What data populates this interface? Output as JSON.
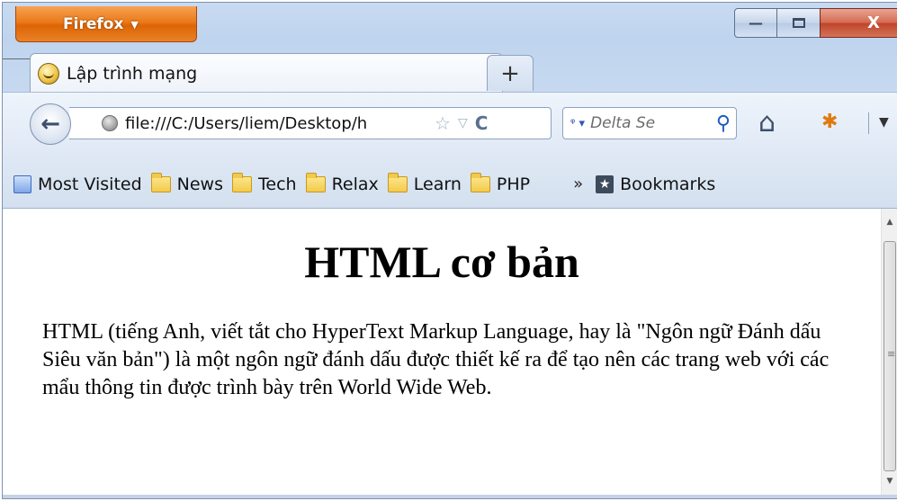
{
  "window": {
    "app_menu_label": "Firefox",
    "minimize_symbol": "—",
    "maximize_symbol": "▫",
    "close_symbol": "X"
  },
  "tab": {
    "title": "Lập trình mạng",
    "new_tab_symbol": "+"
  },
  "navigation": {
    "url": "file:///C:/Users/liem/Desktop/h",
    "search_placeholder": "Delta Se"
  },
  "bookmarks": {
    "items": [
      {
        "label": "Most Visited",
        "icon": "most-visited-icon"
      },
      {
        "label": "News",
        "icon": "folder-icon"
      },
      {
        "label": "Tech",
        "icon": "folder-icon"
      },
      {
        "label": "Relax",
        "icon": "folder-icon"
      },
      {
        "label": "Learn",
        "icon": "folder-icon"
      },
      {
        "label": "PHP",
        "icon": "folder-icon"
      }
    ],
    "overflow_symbol": "»",
    "menu_label": "Bookmarks"
  },
  "page": {
    "heading": "HTML cơ bản",
    "paragraph": "HTML (tiếng Anh, viết tắt cho HyperText Markup Language, hay là \"Ngôn ngữ Đánh dấu Siêu văn bản\") là một ngôn ngữ đánh dấu được thiết kế ra để tạo nên các trang web với các mẩu thông tin được trình bày trên World Wide Web."
  },
  "colors": {
    "firefox_button": "#e66f0f",
    "close_button": "#c7472c",
    "chrome_background": "#c6d9f0"
  }
}
